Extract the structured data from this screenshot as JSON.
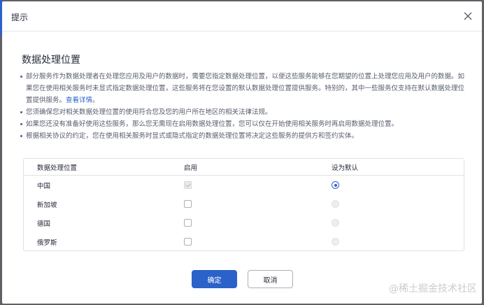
{
  "dialog": {
    "title": "提示",
    "section_title": "数据处理位置",
    "bullets": [
      {
        "text": "部分服务作为数据处理者在处理您应用及用户的数据时，需要您指定数据处理位置，以便这些服务能够在您期望的位置上处理您应用及用户的数据。如果您在使用相关服务时未显式指定数据处理位置，这些服务将在您设置的默认数据处理位置提供服务。特别的，其中一些服务仅支持在默认数据处理位置提供服务。",
        "link": "查看详情",
        "suffix": "。"
      },
      {
        "text": "您须确保您对相关数据处理位置的使用符合您及您的用户所在地区的相关法律法规。"
      },
      {
        "text": "如果您还没有准备好使用这些服务，那么您无需现在启用数据处理位置，您可以仅在开始使用相关服务时再启用数据处理位置。"
      },
      {
        "text": "根据相关协议的约定，您在使用相关服务时显式或隐式指定的数据处理位置将决定这些服务的提供方和签约实体。"
      }
    ],
    "table": {
      "headers": [
        "数据处理位置",
        "启用",
        "设为默认"
      ],
      "rows": [
        {
          "location": "中国",
          "enabled": true,
          "enabled_disabled": true,
          "default": true,
          "default_disabled": false
        },
        {
          "location": "新加坡",
          "enabled": false,
          "enabled_disabled": false,
          "default": false,
          "default_disabled": true
        },
        {
          "location": "德国",
          "enabled": false,
          "enabled_disabled": false,
          "default": false,
          "default_disabled": true
        },
        {
          "location": "俄罗斯",
          "enabled": false,
          "enabled_disabled": false,
          "default": false,
          "default_disabled": true
        }
      ]
    },
    "ok_label": "确定",
    "cancel_label": "取消"
  },
  "watermark": "@稀土掘金技术社区",
  "colors": {
    "accent": "#2a62c9",
    "overlay": "#5f6166",
    "text": "#252b3a"
  }
}
